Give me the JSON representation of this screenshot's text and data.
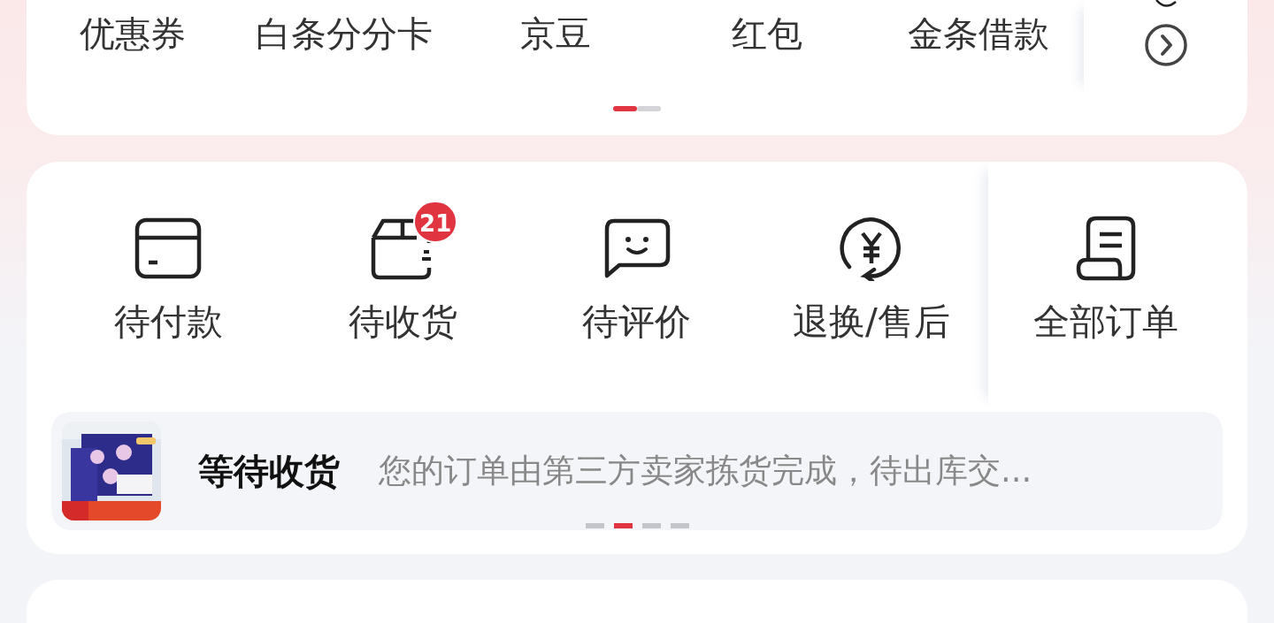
{
  "assets": {
    "items": [
      {
        "label": "优惠券"
      },
      {
        "label": "白条分分卡"
      },
      {
        "label": "京豆"
      },
      {
        "label": "红包"
      },
      {
        "label": "金条借款"
      }
    ],
    "pager": [
      {
        "selected": true
      },
      {
        "selected": false
      }
    ]
  },
  "orders": {
    "items": [
      {
        "kind": "card",
        "label": "待付款"
      },
      {
        "kind": "box",
        "label": "待收货",
        "badge": "21"
      },
      {
        "kind": "chat",
        "label": "待评价"
      },
      {
        "kind": "refund",
        "label": "退换/售后"
      },
      {
        "kind": "receipt",
        "label": "全部订单"
      }
    ],
    "notice": {
      "title": "等待收货",
      "message": "您的订单由第三方卖家拣货完成，待出库交..."
    },
    "pager": [
      {
        "selected": false
      },
      {
        "selected": true
      },
      {
        "selected": false
      },
      {
        "selected": false
      }
    ]
  }
}
